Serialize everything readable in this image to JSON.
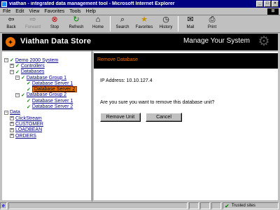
{
  "window": {
    "title": "viathan - integrated data management tool - Microsoft Internet Explorer"
  },
  "menubar": {
    "items": [
      "File",
      "Edit",
      "View",
      "Favorites",
      "Tools",
      "Help"
    ]
  },
  "toolbar": {
    "back": "Back",
    "forward": "Forward",
    "stop": "Stop",
    "refresh": "Refresh",
    "home": "Home",
    "search": "Search",
    "favorites": "Favorites",
    "history": "History",
    "mail": "Mail",
    "print": "Print"
  },
  "header": {
    "brand": "Viathan Data Store",
    "tagline": "Manage Your System"
  },
  "tree": {
    "root": "Demo 2000 System",
    "controllers": "Controllers",
    "databases": "Databases",
    "group1": "Database Group 1",
    "g1_server1": "Database Server 1",
    "g1_server2": "Database Server 2",
    "group2": "Database Group 2",
    "g2_server1": "Database Server 1",
    "g2_server2": "Database Server 2",
    "data": "Data",
    "clickstream": "ClickStream",
    "customer": "CUSTOMER",
    "loadbean": "LOADBEAN",
    "orders": "ORDERS"
  },
  "main": {
    "title": "Remove Database",
    "ip_line": "IP Address: 10.10.127.4",
    "confirm": "Are you sure you want to remove this database unit?",
    "remove_label": "Remove Unit",
    "cancel_label": "Cancel"
  },
  "status": {
    "zone": "Trusted sites"
  },
  "colors": {
    "accent": "#e87000",
    "titlebar": "#000080",
    "check": "#008000",
    "link": "#00008b"
  }
}
